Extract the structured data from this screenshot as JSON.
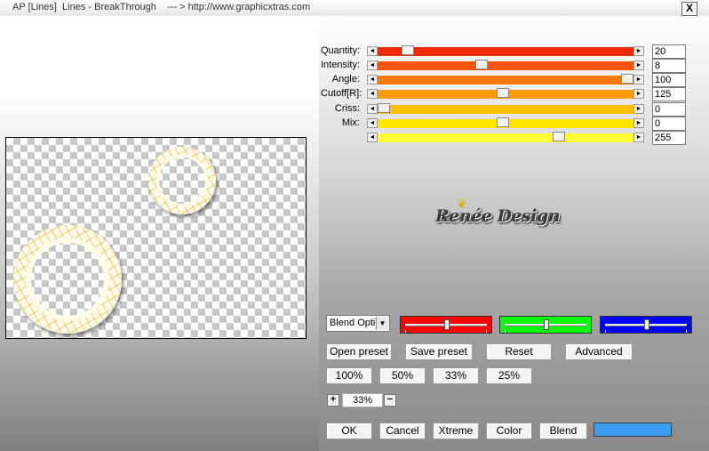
{
  "window": {
    "title": "AP [Lines]  Lines - BreakThrough    --- > http://www.graphicxtras.com",
    "close_label": "X"
  },
  "sliders": [
    {
      "label": "Quantity:",
      "value": "20",
      "color": "#ee2a00",
      "level": 0.1
    },
    {
      "label": "Intensity:",
      "value": "8",
      "color": "#ff5500",
      "level": 0.4
    },
    {
      "label": "Angle:",
      "value": "100",
      "color": "#ff7a00",
      "level": 1.0
    },
    {
      "label": "Cutoff[R]:",
      "value": "125",
      "color": "#ff9a00",
      "level": 0.49
    },
    {
      "label": "Criss:",
      "value": "0",
      "color": "#ffc000",
      "level": 0.0
    },
    {
      "label": "Mix:",
      "value": "0",
      "color": "#ffe500",
      "level": 0.49
    },
    {
      "label": "",
      "value": "255",
      "color": "#ffff33",
      "level": 0.72
    }
  ],
  "logo": {
    "text": "Renée Design"
  },
  "blend_select": {
    "value": "Blend Optio"
  },
  "color_sliders": [
    {
      "name": "red",
      "color": "#ff0000",
      "level": 0.5
    },
    {
      "name": "green",
      "color": "#00ff00",
      "level": 0.5
    },
    {
      "name": "blue",
      "color": "#0000ff",
      "level": 0.5
    }
  ],
  "buttons": {
    "open_preset": "Open preset",
    "save_preset": "Save preset",
    "reset": "Reset",
    "advanced": "Advanced",
    "zoom_100": "100%",
    "zoom_50": "50%",
    "zoom_33": "33%",
    "zoom_25": "25%",
    "plus": "+",
    "minus": "−",
    "ok": "OK",
    "cancel": "Cancel",
    "xtreme": "Xtreme",
    "color": "Color",
    "blend": "Blend"
  },
  "zoom": {
    "value": "33%"
  },
  "color_swatch": {
    "color": "#3a9ef0"
  }
}
